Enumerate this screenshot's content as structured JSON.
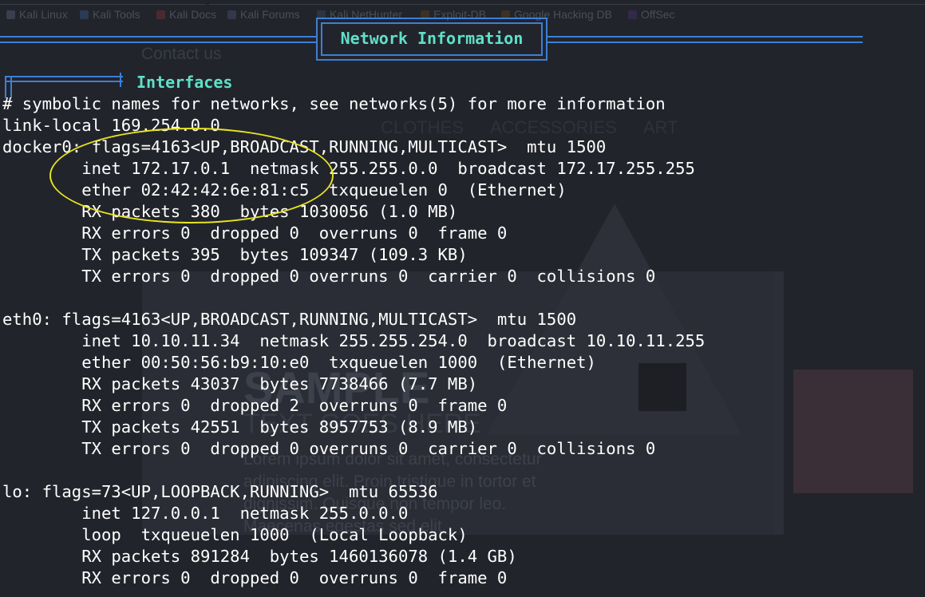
{
  "browser": {
    "bookmarks": [
      "Kali Linux",
      "Kali Tools",
      "Kali Docs",
      "Kali Forums",
      "Kali NetHunter",
      "Exploit-DB",
      "Google Hacking DB",
      "OffSec"
    ]
  },
  "background_site": {
    "contact_link": "Contact us",
    "nav": [
      "CLOTHES",
      "ACCESSORIES",
      "ART"
    ],
    "hero_title": "SAMPLE",
    "hero_subtitle": "TEXT GOES HERE",
    "lorem": [
      "Lorem ipsum dolor sit amet, consectetur",
      "adipiscing elit. Proin tristique in tortor et",
      "dignissim. Quisque non tempor leo.",
      "Maecenas egestas sed elit."
    ]
  },
  "terminal": {
    "banner_title": "Network Information",
    "section_title": "Interfaces",
    "lines": [
      "# symbolic names for networks, see networks(5) for more information",
      "link-local 169.254.0.0",
      "docker0: flags=4163<UP,BROADCAST,RUNNING,MULTICAST>  mtu 1500",
      "        inet 172.17.0.1  netmask 255.255.0.0  broadcast 172.17.255.255",
      "        ether 02:42:42:6e:81:c5  txqueuelen 0  (Ethernet)",
      "        RX packets 380  bytes 1030056 (1.0 MB)",
      "        RX errors 0  dropped 0  overruns 0  frame 0",
      "        TX packets 395  bytes 109347 (109.3 KB)",
      "        TX errors 0  dropped 0 overruns 0  carrier 0  collisions 0",
      "",
      "eth0: flags=4163<UP,BROADCAST,RUNNING,MULTICAST>  mtu 1500",
      "        inet 10.10.11.34  netmask 255.255.254.0  broadcast 10.10.11.255",
      "        ether 00:50:56:b9:10:e0  txqueuelen 1000  (Ethernet)",
      "        RX packets 43037  bytes 7738466 (7.7 MB)",
      "        RX errors 0  dropped 2  overruns 0  frame 0",
      "        TX packets 42551  bytes 8957753 (8.9 MB)",
      "        TX errors 0  dropped 0 overruns 0  carrier 0  collisions 0",
      "",
      "lo: flags=73<UP,LOOPBACK,RUNNING>  mtu 65536",
      "        inet 127.0.0.1  netmask 255.0.0.0",
      "        loop  txqueuelen 1000  (Local Loopback)",
      "        RX packets 891284  bytes 1460136078 (1.4 GB)",
      "        RX errors 0  dropped 0  overruns 0  frame 0"
    ]
  },
  "colors": {
    "terminal_bg": "#22242b",
    "banner_border": "#3c7fd6",
    "heading_text": "#5fe0c8",
    "annotation": "#e6e321"
  }
}
